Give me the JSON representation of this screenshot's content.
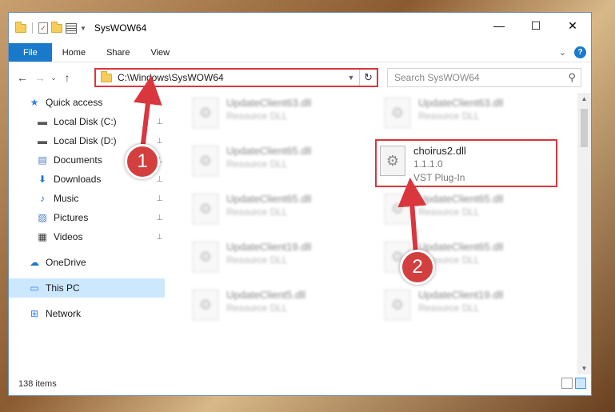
{
  "window": {
    "title": "SysWOW64",
    "minimize": "—",
    "maximize": "☐",
    "close": "✕"
  },
  "ribbon": {
    "tabs": [
      "File",
      "Home",
      "Share",
      "View"
    ],
    "expand": "⌄",
    "help": "?"
  },
  "navigation": {
    "back": "←",
    "forward": "→",
    "recent": "⌄",
    "up": "↑",
    "address": "C:\\Windows\\SysWOW64",
    "address_dropdown": "▼",
    "refresh": "↻",
    "search_placeholder": "Search SysWOW64",
    "search_icon": "⚲"
  },
  "sidebar": {
    "items": [
      {
        "label": "Quick access",
        "icon": "star-icon",
        "glyph": "★",
        "color": "#2f80ed",
        "pinned": false
      },
      {
        "label": "Local Disk (C:)",
        "icon": "drive-icon",
        "glyph": "▬",
        "color": "#555555",
        "pinned": true
      },
      {
        "label": "Local Disk (D:)",
        "icon": "drive-icon",
        "glyph": "▬",
        "color": "#555555",
        "pinned": true
      },
      {
        "label": "Documents",
        "icon": "documents-icon",
        "glyph": "▤",
        "color": "#4a7ab8",
        "pinned": true
      },
      {
        "label": "Downloads",
        "icon": "downloads-icon",
        "glyph": "⬇",
        "color": "#1979ca",
        "pinned": true
      },
      {
        "label": "Music",
        "icon": "music-icon",
        "glyph": "♪",
        "color": "#1979ca",
        "pinned": true
      },
      {
        "label": "Pictures",
        "icon": "pictures-icon",
        "glyph": "▨",
        "color": "#4a7ab8",
        "pinned": true
      },
      {
        "label": "Videos",
        "icon": "videos-icon",
        "glyph": "▦",
        "color": "#333333",
        "pinned": true
      },
      {
        "label": "OneDrive",
        "icon": "onedrive-icon",
        "glyph": "☁",
        "color": "#1979ca",
        "pinned": false
      },
      {
        "label": "This PC",
        "icon": "computer-icon",
        "glyph": "▭",
        "color": "#2f80ed",
        "pinned": false
      },
      {
        "label": "Network",
        "icon": "network-icon",
        "glyph": "⊞",
        "color": "#2f80ed",
        "pinned": false
      }
    ],
    "pin_glyph": "📌"
  },
  "files": {
    "left_column": [
      {
        "name": "UpdateClient63.dll",
        "type": "Resource DLL"
      },
      {
        "name": "UpdateClient65.dll",
        "type": "Resource DLL"
      },
      {
        "name": "UpdateClient65.dll",
        "type": "Resource DLL"
      },
      {
        "name": "UpdateClient19.dll",
        "type": "Resource DLL"
      },
      {
        "name": "UpdateClient5.dll",
        "type": "Resource DLL"
      }
    ],
    "right_column": [
      {
        "name": "UpdateClient63.dll",
        "type": "Resource DLL"
      },
      {
        "name": "UpdateClient65.dll",
        "type": "Resource DLL"
      },
      {
        "name": "UpdateClient65.dll",
        "type": "Resource DLL"
      },
      {
        "name": "UpdateClient19.dll",
        "type": "Resource DLL"
      }
    ],
    "highlighted": {
      "name": "choirus2.dll",
      "version": "1.1.1.0",
      "type": "VST Plug-In"
    }
  },
  "status": {
    "item_count": "138 items"
  },
  "annotations": {
    "step1": "1",
    "step2": "2",
    "highlight_color": "#d9363e"
  }
}
